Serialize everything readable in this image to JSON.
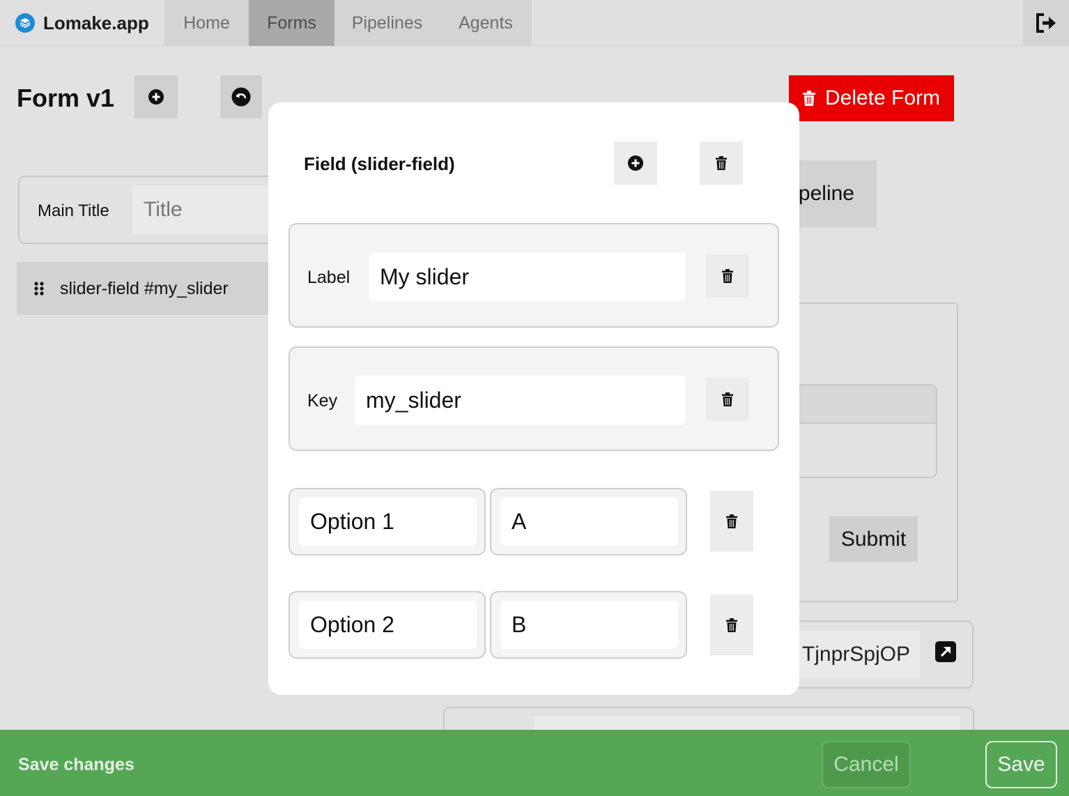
{
  "app": {
    "name": "Lomake.app",
    "accent_color": "#1d8ad6"
  },
  "nav": {
    "tabs": [
      {
        "label": "Home",
        "active": false
      },
      {
        "label": "Forms",
        "active": true
      },
      {
        "label": "Pipelines",
        "active": false
      },
      {
        "label": "Agents",
        "active": false
      }
    ],
    "logout_icon": "logout-icon"
  },
  "page": {
    "title": "Form v1",
    "delete_form_label": "Delete Form",
    "delete_color": "#e80000"
  },
  "form_editor": {
    "main_title_label": "Main Title",
    "main_title_placeholder": "Title",
    "fields": [
      {
        "label": "slider-field #my_slider"
      }
    ]
  },
  "background_right": {
    "pipeline_label": "peline",
    "submit_label": "Submit",
    "link_value": "TjnprSpjOP"
  },
  "modal": {
    "title": "Field (slider-field)",
    "properties": [
      {
        "label": "Label",
        "value": "My slider"
      },
      {
        "label": "Key",
        "value": "my_slider"
      }
    ],
    "options": [
      {
        "name": "Option 1",
        "value": "A"
      },
      {
        "name": "Option 2",
        "value": "B"
      }
    ]
  },
  "save_bar": {
    "text": "Save changes",
    "cancel_label": "Cancel",
    "save_label": "Save",
    "color": "#55a655"
  }
}
